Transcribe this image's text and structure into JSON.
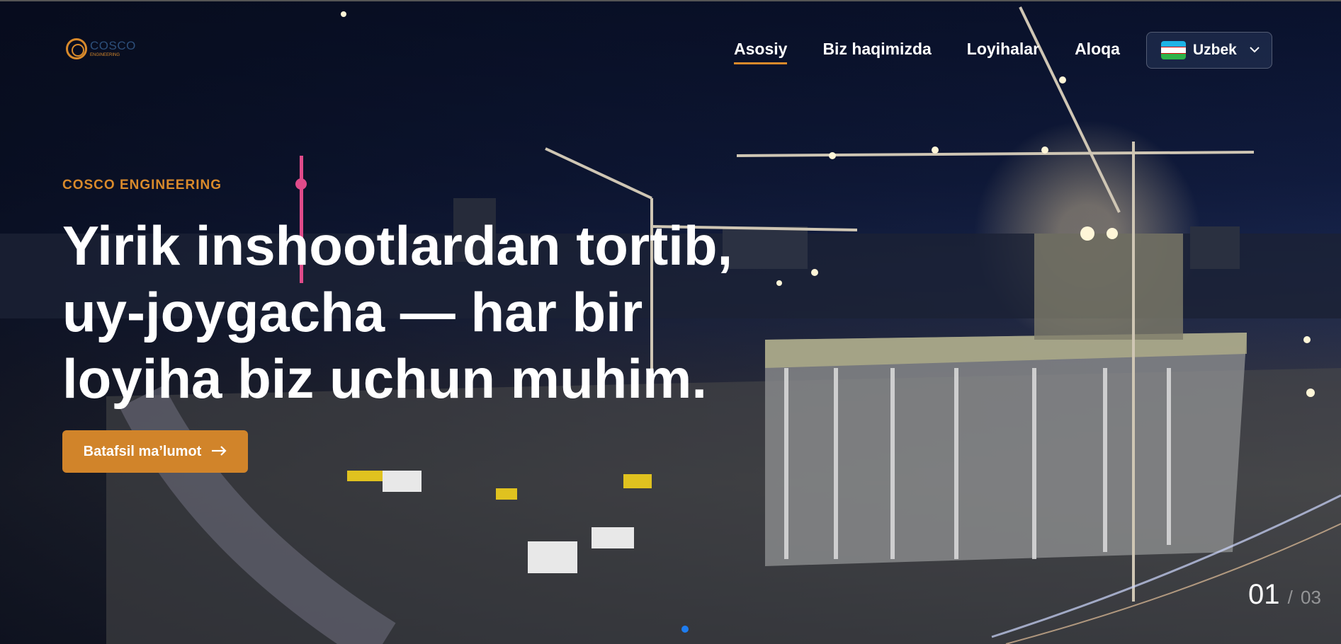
{
  "brand": {
    "name": "COSCO",
    "sub": "ENGINEERING",
    "accent": "#d98a2b"
  },
  "nav": {
    "items": [
      {
        "label": "Asosiy",
        "active": true
      },
      {
        "label": "Biz haqimizda",
        "active": false
      },
      {
        "label": "Loyihalar",
        "active": false
      },
      {
        "label": "Aloqa",
        "active": false
      }
    ]
  },
  "language": {
    "label": "Uzbek",
    "flag_icon": "uzbekistan-flag-icon"
  },
  "hero": {
    "eyebrow": "COSCO ENGINEERING",
    "headline_lines": [
      "Yirik inshootlardan tortib,",
      "uy-joygacha — har bir",
      "loyiha biz uchun muhim."
    ],
    "cta_label": "Batafsil ma’lumot",
    "cta_icon": "arrow-right-icon"
  },
  "slider": {
    "current": "01",
    "separator": "/",
    "total": "03"
  }
}
